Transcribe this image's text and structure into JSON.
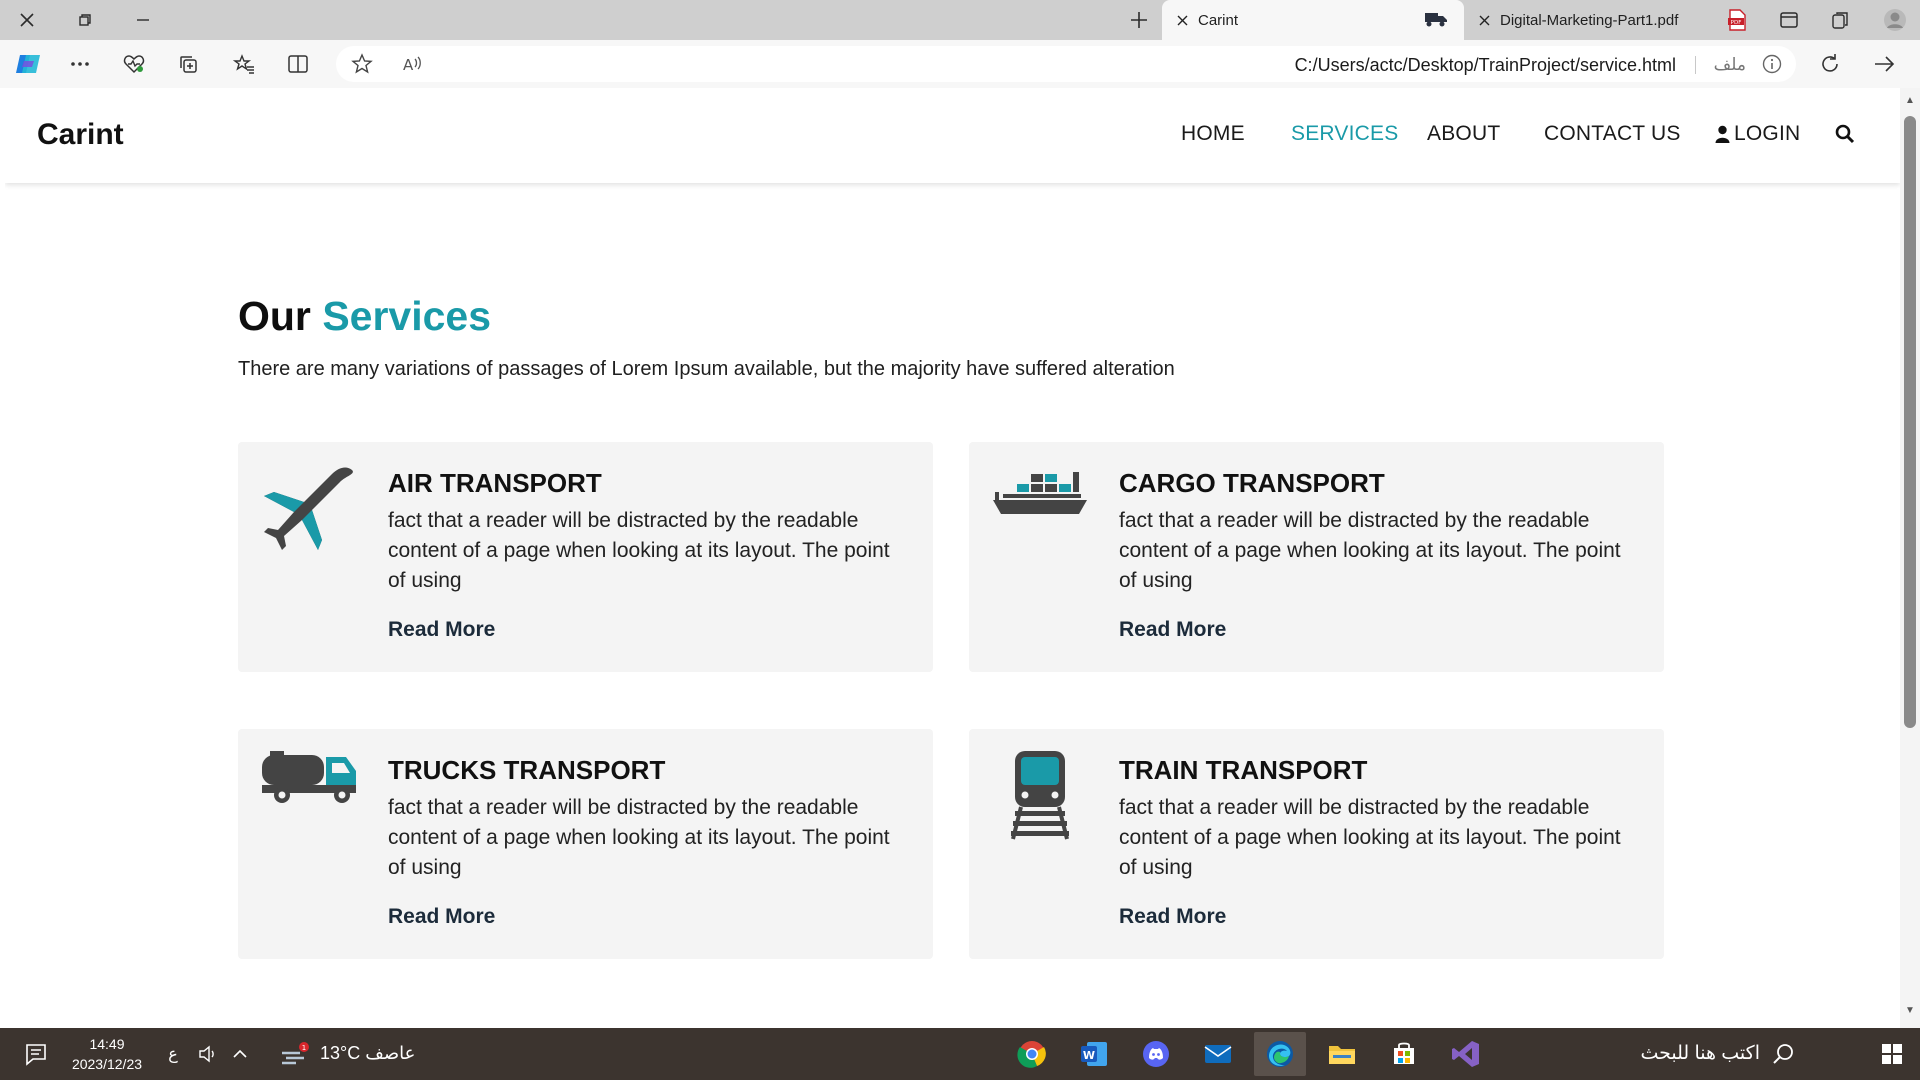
{
  "browser": {
    "tabs": [
      {
        "label": "Carint",
        "active": true
      },
      {
        "label": "Digital-Marketing-Part1.pdf",
        "active": false
      }
    ],
    "address": {
      "url": "C:/Users/actc/Desktop/TrainProject/service.html",
      "scheme_label": "ملف"
    }
  },
  "site": {
    "brand": "Carint",
    "nav": {
      "home": "HOME",
      "services": "SERVICES",
      "about": "ABOUT",
      "contact": "CONTACT US",
      "login": "LOGIN"
    },
    "section": {
      "title_main": "Our",
      "title_accent": "Services",
      "subtitle": "There are many variations of passages of Lorem Ipsum available, but the majority have suffered alteration"
    },
    "services": [
      {
        "title": "AIR TRANSPORT",
        "text": "fact that a reader will be distracted by the readable content of a page when looking at its layout. The point of using",
        "link": "Read More",
        "icon": "airplane-icon"
      },
      {
        "title": "CARGO TRANSPORT",
        "text": "fact that a reader will be distracted by the readable content of a page when looking at its layout. The point of using",
        "link": "Read More",
        "icon": "cargo-ship-icon"
      },
      {
        "title": "TRUCKS TRANSPORT",
        "text": "fact that a reader will be distracted by the readable content of a page when looking at its layout. The point of using",
        "link": "Read More",
        "icon": "truck-icon"
      },
      {
        "title": "TRAIN TRANSPORT",
        "text": "fact that a reader will be distracted by the readable content of a page when looking at its layout. The point of using",
        "link": "Read More",
        "icon": "train-icon"
      }
    ]
  },
  "colors": {
    "accent": "#1a9aa8",
    "icon_dark": "#444444",
    "card_bg": "#f4f4f4",
    "taskbar_bg": "#3c342f"
  },
  "taskbar": {
    "time": "14:49",
    "date": "2023/12/23",
    "lang": "ع",
    "weather": "13°C  عاصف",
    "weather_badge": "1",
    "search_placeholder": "اكتب هنا للبحث"
  }
}
